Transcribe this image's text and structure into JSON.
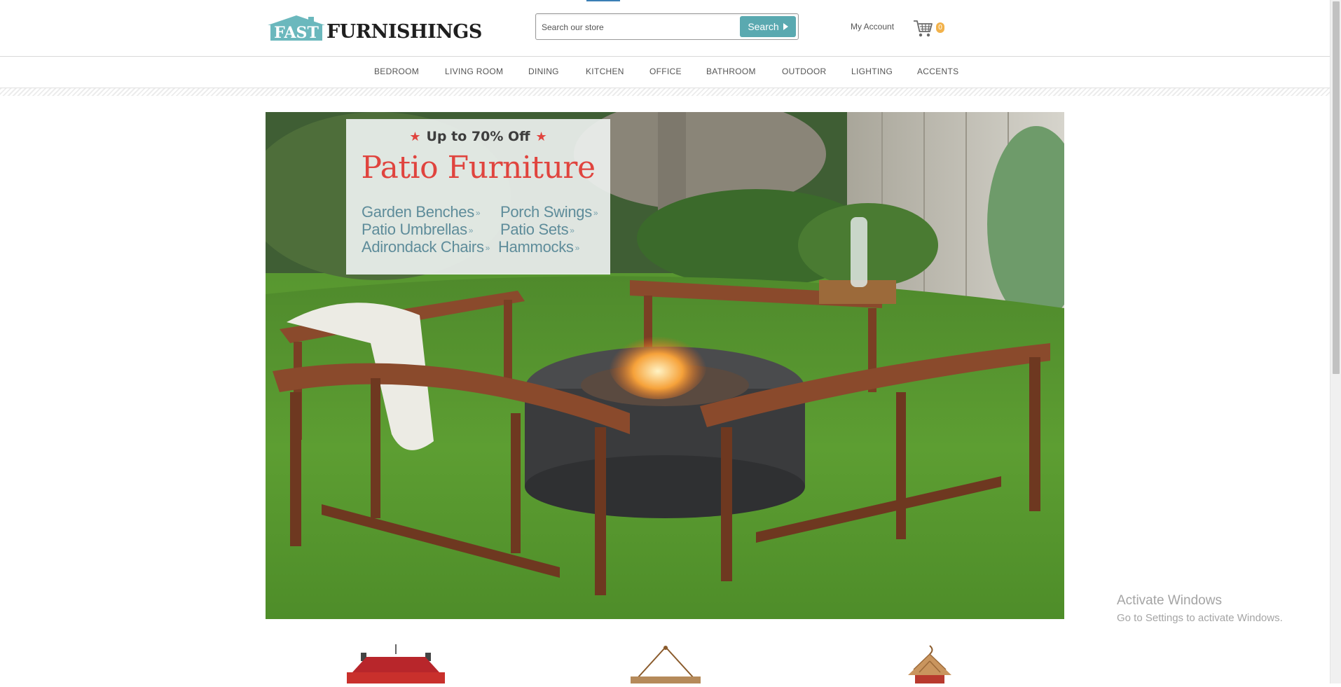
{
  "brand": {
    "logo_house_text": "FAST",
    "logo_word": "FURNISHINGS",
    "accent_color": "#5aa9b0",
    "promo_red": "#e0443e"
  },
  "search": {
    "placeholder": "Search our store",
    "button_label": "Search",
    "button_icon": "play-triangle-icon"
  },
  "account": {
    "label": "My Account"
  },
  "cart": {
    "icon": "shopping-cart-icon",
    "count": "0"
  },
  "categories": [
    "BEDROOM",
    "LIVING ROOM",
    "DINING",
    "KITCHEN",
    "OFFICE",
    "BATHROOM",
    "OUTDOOR",
    "LIGHTING",
    "ACCENTS"
  ],
  "hero": {
    "subtitle": "Up to 70% Off",
    "title": "Patio Furniture",
    "links": [
      "Garden Benches",
      "Porch Swings",
      "Patio Umbrellas",
      "Patio Sets",
      "Adirondack Chairs",
      "Hammocks"
    ],
    "link_suffix": "»",
    "star_glyph": "★"
  },
  "products": [
    {
      "icon": "red-bird-feeder-thumbnail"
    },
    {
      "icon": "hanging-sign-thumbnail"
    },
    {
      "icon": "birdhouse-thumbnail"
    }
  ],
  "watermark": {
    "title": "Activate Windows",
    "subtitle": "Go to Settings to activate Windows."
  }
}
